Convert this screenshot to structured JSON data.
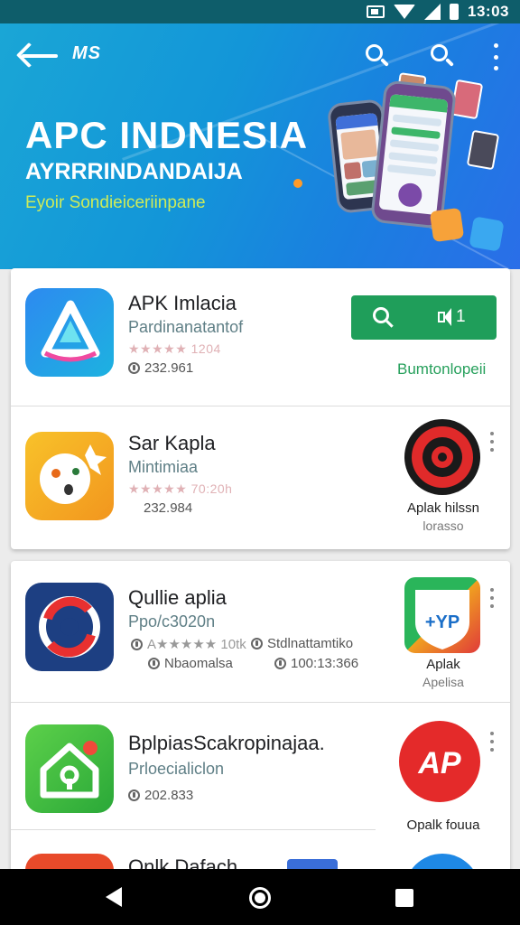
{
  "status_bar": {
    "time": "13:03"
  },
  "header": {
    "brand": "MS",
    "title": "APC INDNESIA",
    "subtitle": "AYRRRINDANDAIJA",
    "tagline": "Eyoir Sondieiceriinpane"
  },
  "apps": [
    {
      "name": "APK Imlacia",
      "developer": "Pardinanatantof",
      "rating_text": "★★★★★ 1204",
      "count": "232.961",
      "install_label": "1",
      "secondary_label": "Bumtonlopeii"
    },
    {
      "name": "Sar Kapla",
      "developer": "Mintimiaa",
      "rating_text": "★★★★★ 70:20h",
      "count": "232.984",
      "side_label": "Aplak hilssn",
      "side_sub": "lorasso"
    },
    {
      "name": "Qullie aplia",
      "developer": "Ppo/c3020n",
      "rating_text": "A★★★★★ 10tk",
      "count": "Nbaomalsa",
      "extra_label": "Stdlnattamtiko",
      "extra_count": "100:13:366",
      "side_label": "Aplak",
      "side_sub": "Apelisa",
      "side_logo_text": "+YP"
    },
    {
      "name": "BplpiasScakropinajaa.",
      "developer": "Prloecialiclon",
      "count": "202.833",
      "side_label": "Opalk fouua",
      "side_logo_text": "AP"
    },
    {
      "name": "Onlk Dafach"
    }
  ],
  "colors": {
    "accent_green": "#1f9e5a",
    "banner_blue": "#1396d8",
    "status_bar": "#0e5d6a"
  }
}
